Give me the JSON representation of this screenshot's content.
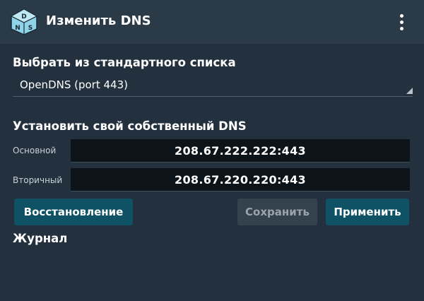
{
  "appbar": {
    "title": "Изменить DNS",
    "logo_letters": [
      "D",
      "N",
      "S"
    ],
    "menu_icon": "more-vert-icon"
  },
  "preset": {
    "label": "Выбрать из стандартного списка",
    "selected": "OpenDNS (port 443)",
    "arrow_icon": "dropdown-triangle-icon"
  },
  "custom": {
    "label": "Установить свой собственный DNS",
    "primary_label": "Основной",
    "primary_value": "208.67.222.222:443",
    "secondary_label": "Вторичный",
    "secondary_value": "208.67.220.220:443"
  },
  "buttons": {
    "restore": "Восстановление",
    "save": "Сохранить",
    "apply": "Применить"
  },
  "log": {
    "label": "Журнал"
  },
  "colors": {
    "background": "#22313d",
    "appbar": "#2a3a47",
    "accent_button": "#0f5266",
    "disabled_button": "#34424d",
    "field": "#0c1419"
  }
}
